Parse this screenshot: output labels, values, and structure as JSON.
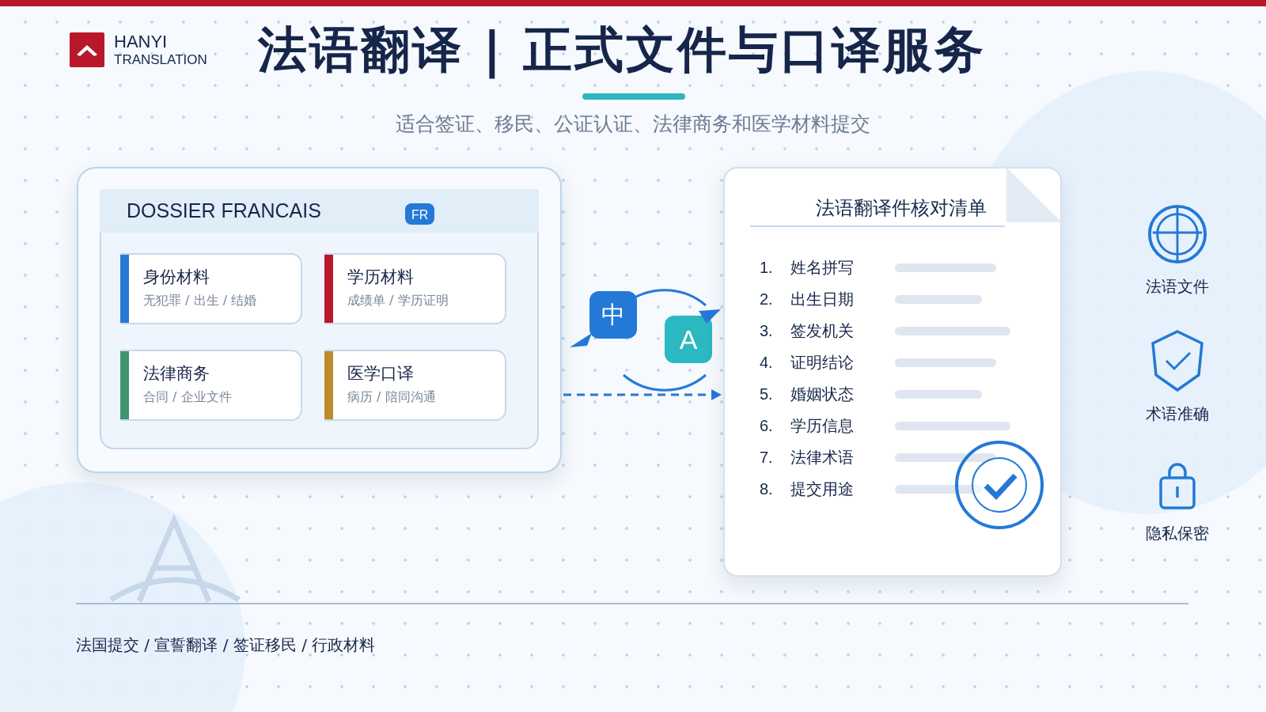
{
  "brand": {
    "name": "HANYI",
    "tagline": "TRANSLATION"
  },
  "title": "法语翻译 | 正式文件与口译服务",
  "subtitle": "适合签证、移民、公证认证、法律商务和医学材料提交",
  "dossier": {
    "title": "DOSSIER FRANCAIS",
    "badge": "FR",
    "categories": [
      {
        "title": "身份材料",
        "detail": "无犯罪 / 出生 / 结婚",
        "color": "#2479d6"
      },
      {
        "title": "学历材料",
        "detail": "成绩单 / 学历证明",
        "color": "#b8182a"
      },
      {
        "title": "法律商务",
        "detail": "合同 / 企业文件",
        "color": "#3f9470"
      },
      {
        "title": "医学口译",
        "detail": "病历 / 陪同沟通",
        "color": "#bf8a2a"
      }
    ]
  },
  "translation": {
    "source": "中",
    "target": "A"
  },
  "checklist": {
    "title": "法语翻译件核对清单",
    "items": [
      {
        "number": "1.",
        "label": "姓名拼写"
      },
      {
        "number": "2.",
        "label": "出生日期"
      },
      {
        "number": "3.",
        "label": "签发机关"
      },
      {
        "number": "4.",
        "label": "证明结论"
      },
      {
        "number": "5.",
        "label": "婚姻状态"
      },
      {
        "number": "6.",
        "label": "学历信息"
      },
      {
        "number": "7.",
        "label": "法律术语"
      },
      {
        "number": "8.",
        "label": "提交用途"
      }
    ]
  },
  "features": [
    {
      "kind": "globe",
      "label": "法语文件"
    },
    {
      "kind": "shield",
      "label": "术语准确"
    },
    {
      "kind": "lock",
      "label": "隐私保密"
    }
  ],
  "footer": "法国提交 / 宣誓翻译 / 签证移民 / 行政材料"
}
